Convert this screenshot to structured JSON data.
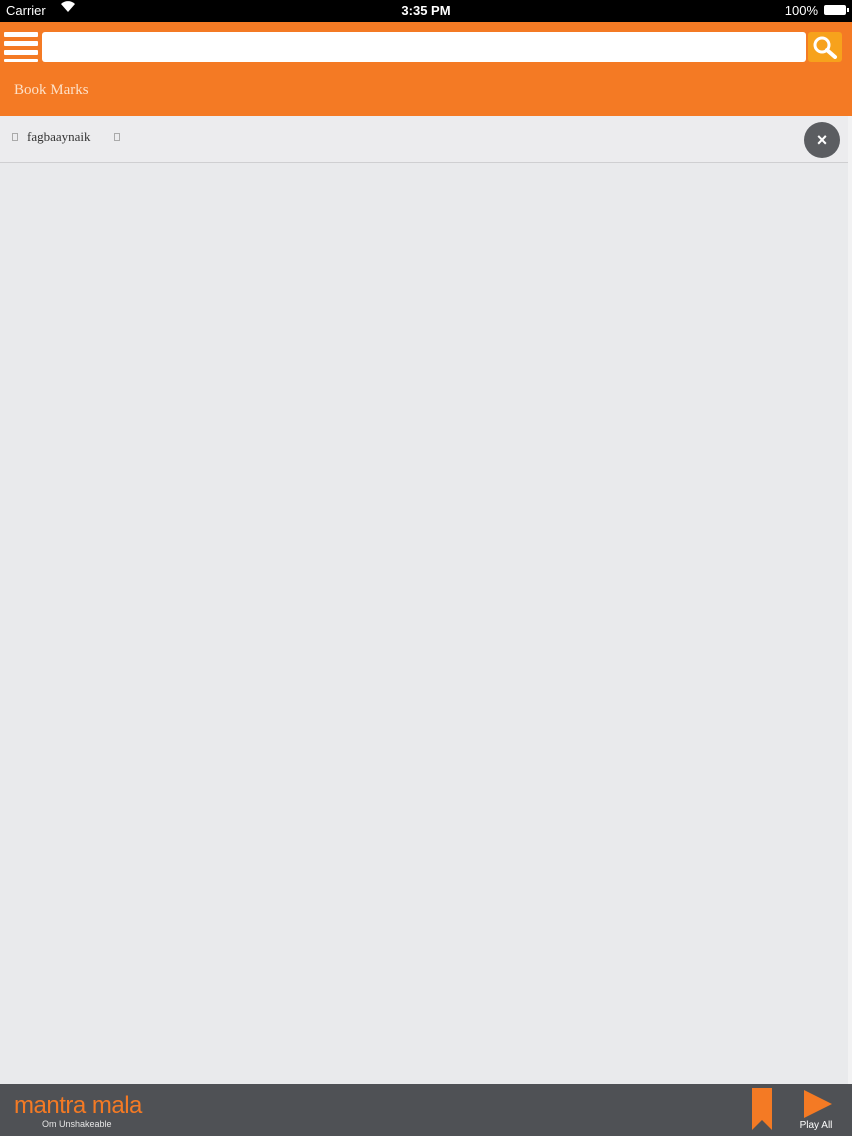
{
  "status_bar": {
    "carrier": "Carrier",
    "time": "3:35 PM",
    "battery": "100%"
  },
  "toolbar": {
    "search_placeholder": "",
    "menu_icon": "hamburger-icon",
    "search_icon": "search-icon"
  },
  "section": {
    "title": "Book Marks"
  },
  "bookmarks": [
    {
      "label": "fagbaaynaik",
      "remove_icon": "close-icon"
    }
  ],
  "footer": {
    "logo": "mantra mala",
    "tagline": "Om Unshakeable",
    "play_label": "Play All"
  },
  "colors": {
    "accent": "#f47a24",
    "search_button": "#f7a21c",
    "footer_bg": "#4f5155",
    "content_bg": "#e9eaec"
  }
}
